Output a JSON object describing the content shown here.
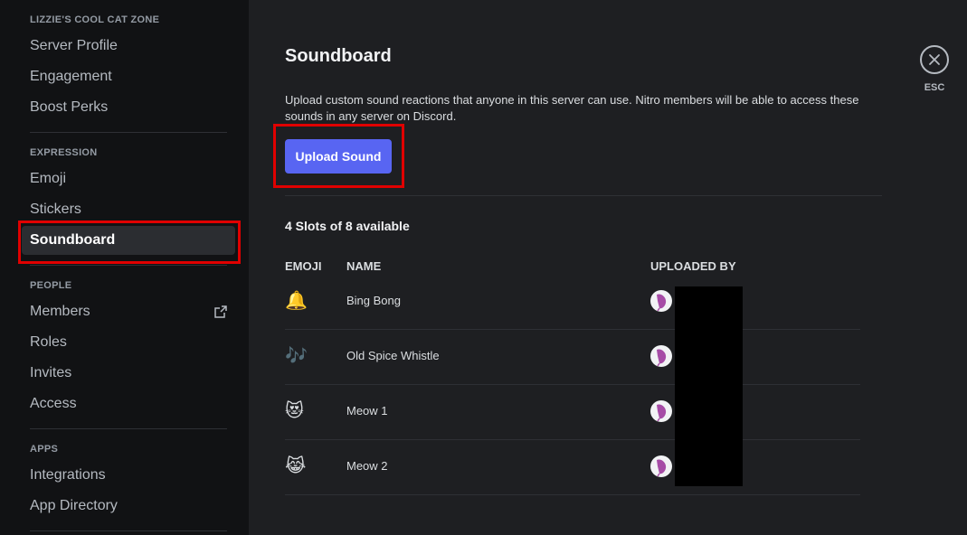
{
  "sidebar": {
    "server_header": "LIZZIE'S COOL CAT ZONE",
    "server_items": [
      {
        "label": "Server Profile"
      },
      {
        "label": "Engagement"
      },
      {
        "label": "Boost Perks"
      }
    ],
    "expression_header": "EXPRESSION",
    "expression_items": [
      {
        "label": "Emoji"
      },
      {
        "label": "Stickers"
      },
      {
        "label": "Soundboard"
      }
    ],
    "people_header": "PEOPLE",
    "people_items": [
      {
        "label": "Members",
        "icon": "external-link-icon"
      },
      {
        "label": "Roles"
      },
      {
        "label": "Invites"
      },
      {
        "label": "Access"
      }
    ],
    "apps_header": "APPS",
    "apps_items": [
      {
        "label": "Integrations"
      },
      {
        "label": "App Directory"
      }
    ]
  },
  "main": {
    "title": "Soundboard",
    "description": "Upload custom sound reactions that anyone in this server can use. Nitro members will be able to access these sounds in any server on Discord.",
    "upload_button": "Upload Sound",
    "slots_text": "4 Slots of 8 available",
    "columns": {
      "emoji": "EMOJI",
      "name": "NAME",
      "uploaded_by": "UPLOADED BY"
    },
    "sounds": [
      {
        "emoji": "🔔",
        "emoji_name": "bell",
        "name": "Bing Bong"
      },
      {
        "emoji": "🎶",
        "emoji_name": "musical-notes",
        "name": "Old Spice Whistle"
      },
      {
        "emoji": "😻",
        "emoji_name": "heart-eyes-cat",
        "name": "Meow 1"
      },
      {
        "emoji": "😹",
        "emoji_name": "joy-cat",
        "name": "Meow 2"
      }
    ]
  },
  "close": {
    "label": "ESC",
    "icon": "close-icon"
  },
  "colors": {
    "accent": "#5865f2",
    "highlight": "#e00000",
    "sidebar_bg": "#111214",
    "main_bg": "#1e1f22"
  }
}
